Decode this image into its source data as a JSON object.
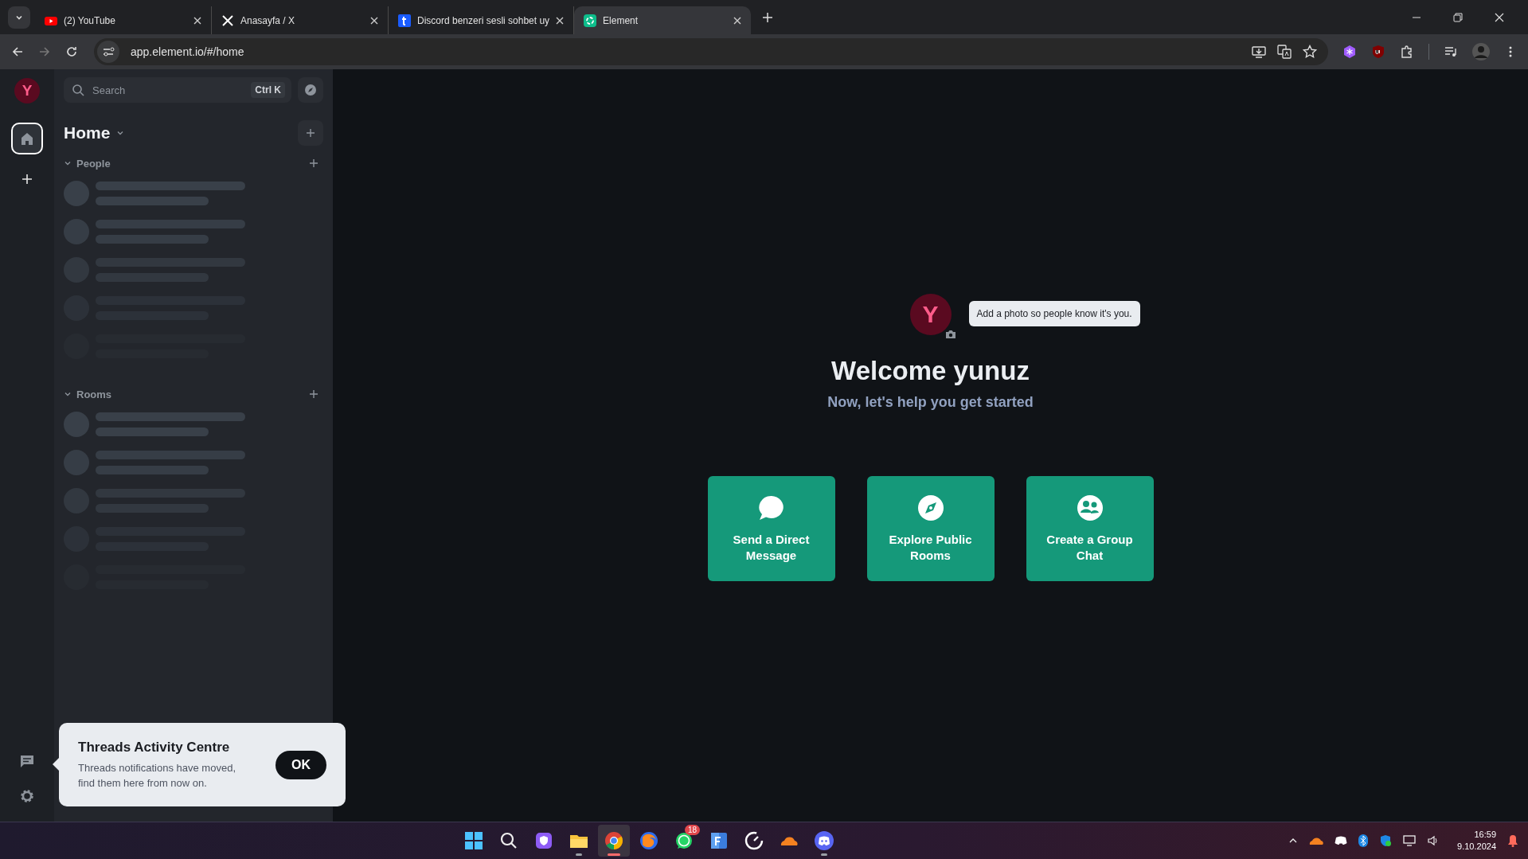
{
  "browser": {
    "tabs": [
      {
        "title": "(2) YouTube",
        "kind": "youtube",
        "selected": false
      },
      {
        "title": "Anasayfa / X",
        "kind": "x",
        "selected": false
      },
      {
        "title": "Discord benzeri sesli sohbet uy",
        "kind": "t",
        "selected": false
      },
      {
        "title": "Element",
        "kind": "element",
        "selected": true
      }
    ],
    "url": "app.element.io/#/home"
  },
  "rail": {
    "avatar_initial": "Y"
  },
  "sidebar": {
    "search": {
      "placeholder": "Search",
      "shortcut": "Ctrl K"
    },
    "title": "Home",
    "sections": [
      {
        "title": "People",
        "expanded": true
      },
      {
        "title": "Rooms",
        "expanded": true
      }
    ]
  },
  "main": {
    "avatar_initial": "Y",
    "tooltip": "Add a photo so people know it's you.",
    "title": "Welcome yunuz",
    "subtitle": "Now, let's help you get started",
    "actions": [
      {
        "label": "Send a Direct Message",
        "kind": "message"
      },
      {
        "label": "Explore Public Rooms",
        "kind": "compass"
      },
      {
        "label": "Create a Group Chat",
        "kind": "group"
      }
    ]
  },
  "popup": {
    "title": "Threads Activity Centre",
    "body": "Threads notifications have moved, find them here from now on.",
    "button": "OK"
  },
  "taskbar": {
    "apps": [
      {
        "kind": "windows",
        "running": false,
        "selected": false
      },
      {
        "kind": "search",
        "running": false,
        "selected": false
      },
      {
        "kind": "shield",
        "running": false,
        "selected": false
      },
      {
        "kind": "folder",
        "running": true,
        "selected": false
      },
      {
        "kind": "chrome",
        "running": true,
        "selected": true
      },
      {
        "kind": "firefox",
        "running": false,
        "selected": false
      },
      {
        "kind": "whatsapp",
        "running": false,
        "selected": false,
        "badge": "18"
      },
      {
        "kind": "f",
        "running": false,
        "selected": false
      },
      {
        "kind": "gauge",
        "running": false,
        "selected": false
      },
      {
        "kind": "cloud",
        "running": false,
        "selected": false
      },
      {
        "kind": "discord",
        "running": true,
        "selected": false
      }
    ],
    "time": "16:59",
    "date": "9.10.2024"
  }
}
